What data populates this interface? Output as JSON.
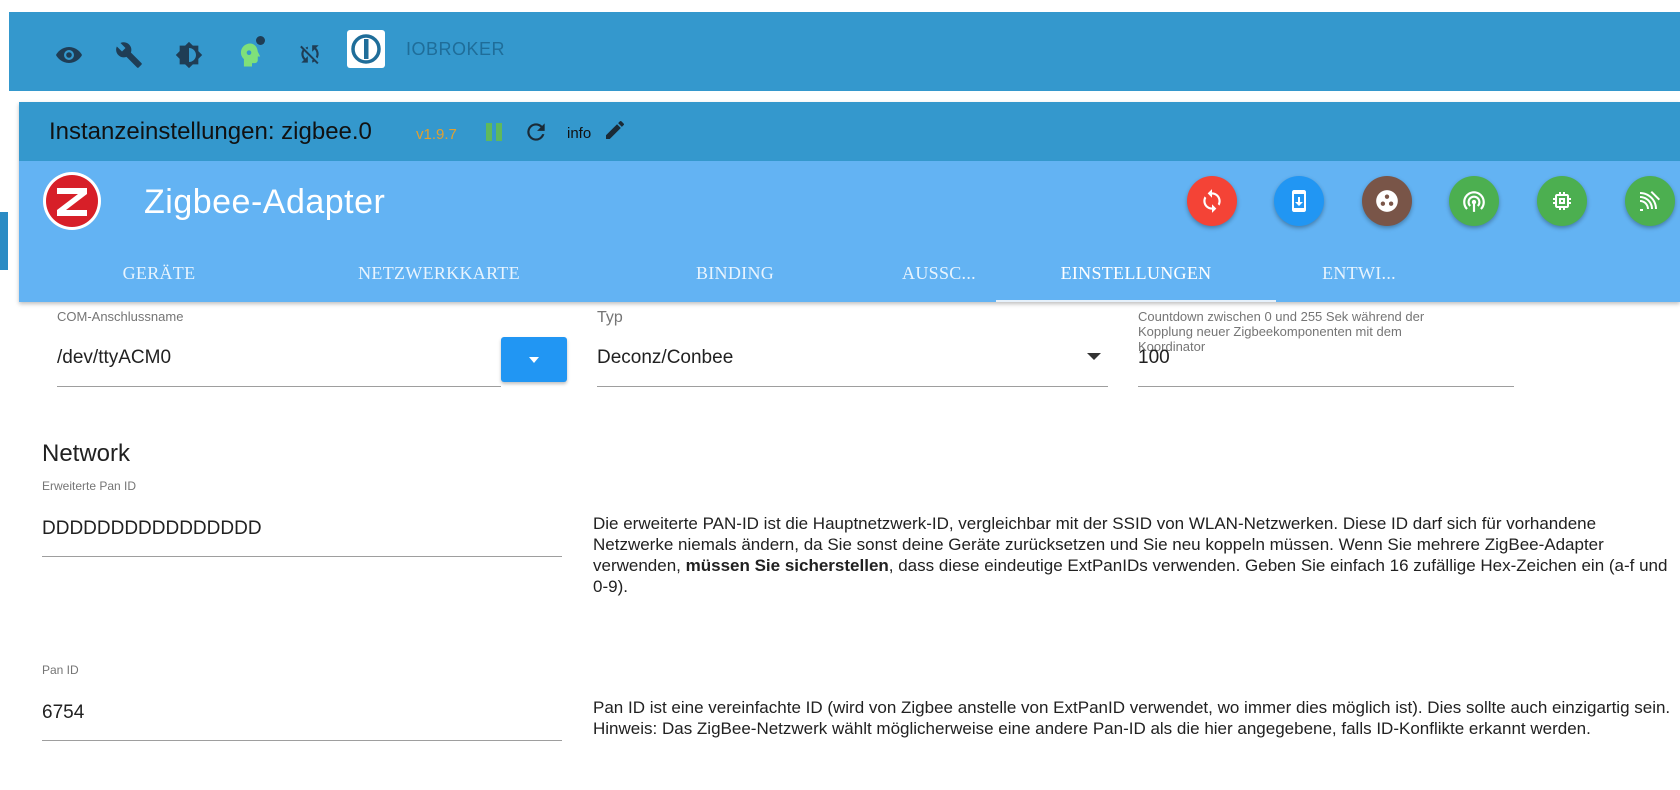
{
  "topbar": {
    "icons": [
      "eye-icon",
      "wrench-icon",
      "brightness-icon",
      "head-icon",
      "sync-off-icon"
    ],
    "logo_text": "IOBROKER"
  },
  "instance": {
    "title": "Instanzeinstellungen: zigbee.0",
    "version": "v1.9.7",
    "info": "info"
  },
  "adapter": {
    "title": "Zigbee-Adapter",
    "buttons": [
      "sync-icon",
      "download-phone-icon",
      "dots-icon",
      "broadcast-icon",
      "chip-icon",
      "signal-icon"
    ],
    "colors": {
      "sync": "#f44336",
      "download": "#2196f3",
      "dots": "#795548",
      "broadcast": "#4caf50",
      "chip": "#4caf50",
      "signal": "#4caf50"
    }
  },
  "tabs": [
    {
      "label": "GERÄTE"
    },
    {
      "label": "NETZWERKKARTE"
    },
    {
      "label": "BINDING"
    },
    {
      "label": "AUSSC..."
    },
    {
      "label": "EINSTELLUNGEN",
      "active": true
    },
    {
      "label": "ENTWI..."
    }
  ],
  "form": {
    "com": {
      "label": "COM-Anschlussname",
      "value": "/dev/ttyACM0"
    },
    "typ": {
      "label": "Typ",
      "value": "Deconz/Conbee"
    },
    "countdown": {
      "label": "Countdown zwischen 0 und 255 Sek während der Kopplung neuer Zigbeekomponenten mit dem Koordinator",
      "value": "100"
    },
    "network_title": "Network",
    "extpan": {
      "label": "Erweiterte Pan ID",
      "value": "DDDDDDDDDDDDDDDD",
      "desc_pre": "Die erweiterte PAN-ID ist die Hauptnetzwerk-ID, vergleichbar mit der SSID von WLAN-Netzwerken. Diese ID darf sich für vorhandene Netzwerke niemals ändern, da Sie sonst deine Geräte zurücksetzen und Sie neu koppeln müssen. Wenn Sie mehrere ZigBee-Adapter verwenden, ",
      "desc_bold": "müssen Sie sicherstellen",
      "desc_post": ", dass diese eindeutige ExtPanIDs verwenden. Geben Sie einfach 16 zufällige Hex-Zeichen ein (a-f und 0-9)."
    },
    "panid": {
      "label": "Pan ID",
      "value": "6754",
      "desc": "Pan ID ist eine vereinfachte ID (wird von Zigbee anstelle von ExtPanID verwendet, wo immer dies möglich ist). Dies sollte auch einzigartig sein. Hinweis: Das ZigBee-Netzwerk wählt möglicherweise eine andere Pan-ID als die hier angegebene, falls ID-Konflikte erkannt werden."
    }
  }
}
